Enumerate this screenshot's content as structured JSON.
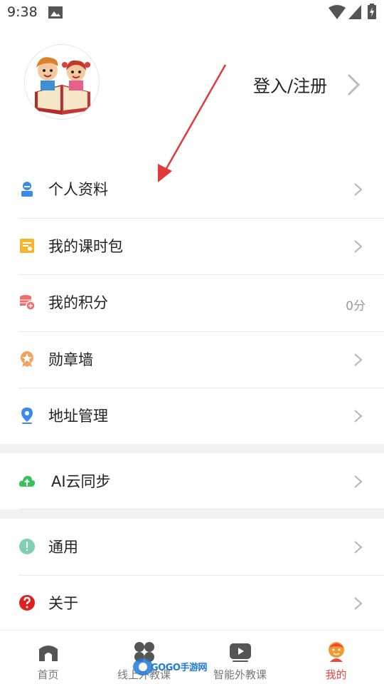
{
  "status_bar": {
    "time": "9:38"
  },
  "profile": {
    "login_label": "登入/注册"
  },
  "menu_group_1": [
    {
      "label": "个人资料",
      "icon": "person-icon"
    },
    {
      "label": "我的课时包",
      "icon": "package-icon"
    },
    {
      "label": "我的积分",
      "icon": "coins-icon",
      "value": "0分"
    },
    {
      "label": "勋章墙",
      "icon": "medal-icon"
    },
    {
      "label": "地址管理",
      "icon": "location-pin-icon"
    }
  ],
  "menu_group_2": [
    {
      "label": "AI云同步",
      "icon": "cloud-upload-icon"
    }
  ],
  "menu_group_3": [
    {
      "label": "通用",
      "icon": "info-circle-icon"
    },
    {
      "label": "关于",
      "icon": "question-circle-icon"
    }
  ],
  "bottom_nav": [
    {
      "label": "首页",
      "icon": "home-icon",
      "active": false
    },
    {
      "label": "线上外教课",
      "icon": "grid-icon",
      "active": false
    },
    {
      "label": "智能外教课",
      "icon": "play-icon",
      "active": false
    },
    {
      "label": "我的",
      "icon": "mascot-icon",
      "active": true
    }
  ],
  "watermark": {
    "text": "GOGO手游网"
  },
  "colors": {
    "accent": "#e8473d",
    "person_icon": "#3b8beb",
    "package_icon": "#f5b52e",
    "coins_icon": "#ef6d6d",
    "medal_icon": "#f0a35a",
    "pin_icon": "#3b8beb",
    "cloud_icon": "#37c25a",
    "info_icon": "#7fcfb2",
    "question_icon": "#e02020",
    "arrow": "#e23a3a"
  }
}
